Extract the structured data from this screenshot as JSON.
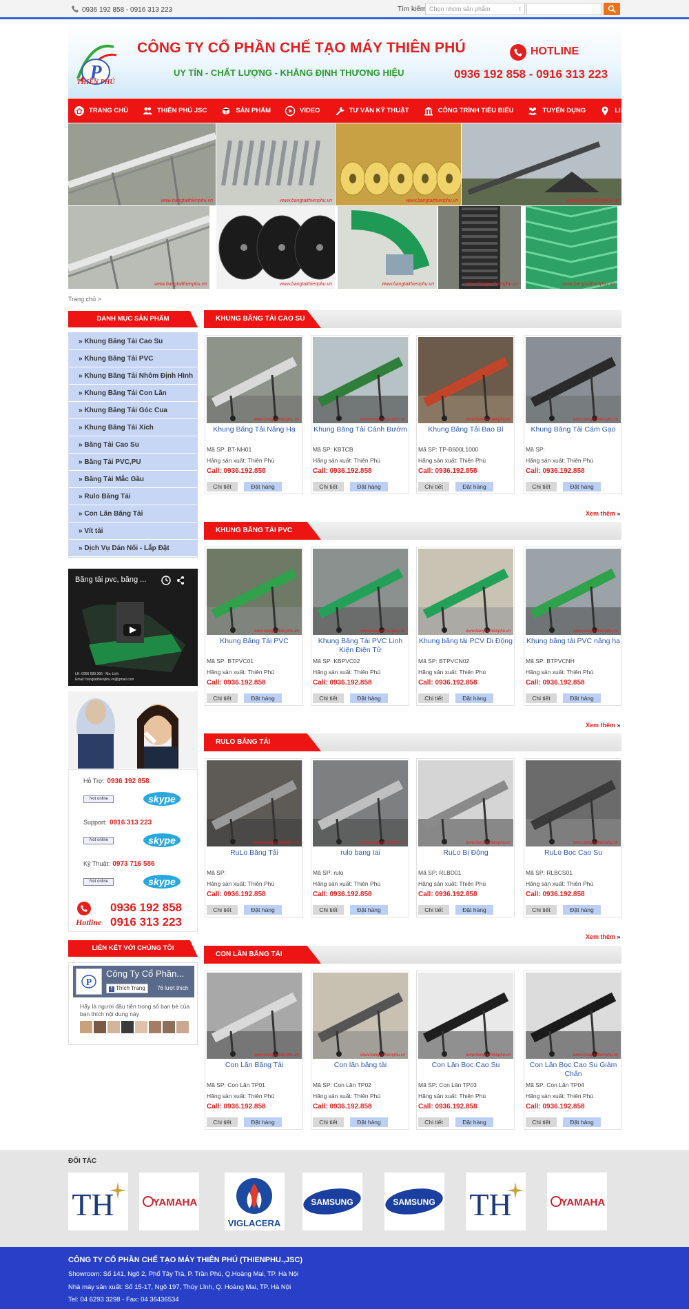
{
  "topbar": {
    "phone": "0936 192 858 - 0916 313 223",
    "search_label": "Tìm kiếm",
    "select_value": "Chọn nhóm sản phẩm",
    "search_value": ""
  },
  "header": {
    "company": "CÔNG TY CỔ PHẦN CHẾ TẠO MÁY THIÊN PHÚ",
    "slogan": "UY TÍN - CHẤT LƯỢNG - KHẲNG ĐỊNH THƯƠNG HIỆU",
    "hotline_label": "HOTLINE",
    "hotline_numbers": "0936 192 858 - 0916 313 223",
    "logo_text": "THIÊN PHÚ",
    "logo_letter": "P"
  },
  "nav": [
    {
      "label": "TRANG CHỦ",
      "icon": "home-icon"
    },
    {
      "label": "THIÊN PHÚ JSC",
      "icon": "users-icon"
    },
    {
      "label": "SẢN PHẨM",
      "icon": "box-icon"
    },
    {
      "label": "VIDEO",
      "icon": "play-icon"
    },
    {
      "label": "TƯ VẤN KỸ THUẬT",
      "icon": "wrench-icon"
    },
    {
      "label": "CÔNG TRÌNH TIÊU BIỂU",
      "icon": "building-icon"
    },
    {
      "label": "TUYỂN DỤNG",
      "icon": "people-icon"
    },
    {
      "label": "LIÊN HỆ",
      "icon": "pin-icon"
    }
  ],
  "breadcrumb": "Trang chủ >",
  "sidebar": {
    "title": "DANH MỤC SẢN PHẨM",
    "items": [
      "Khung Băng Tải Cao Su",
      "Khung Băng Tải PVC",
      "Khung Băng Tải Nhôm Định Hình",
      "Khung Băng Tải Con Lăn",
      "Khung Băng Tải Góc Cua",
      "Khung Băng Tải Xích",
      "Băng Tải Cao Su",
      "Băng Tải PVC,PU",
      "Băng Tải Mắc Gầu",
      "Rulo Băng Tải",
      "Con Lăn Băng Tải",
      "Vít tải",
      "Dịch Vụ Dán Nối - Lắp Đặt"
    ]
  },
  "video": {
    "title": "Băng tải pvc, băng ...",
    "caption": "LH: 0966 699 366 - Ms: Linh",
    "caption2": "Email: bangtaithienphu.vn@gmail.com"
  },
  "support": {
    "rows": [
      {
        "label": "Hỗ Trợ:",
        "phone": "0936 192 858"
      },
      {
        "label": "Support:",
        "phone": "0916 313 223"
      },
      {
        "label": "Kỹ Thuật:",
        "phone": "0973 716 586"
      }
    ],
    "online": "Not online",
    "skype": "skype",
    "big1": "0936 192 858",
    "big2": "0916 313 223",
    "hotline": "Hotline"
  },
  "links": {
    "title": "LIÊN KẾT VỚI CHÚNG TÔI",
    "fb_page": "Công Ty Cổ Phần...",
    "like": "Thích Trang",
    "likes": "76 lượt thích",
    "note": "Hãy là người đầu tiên trong số bạn bè của bạn thích nội dung này"
  },
  "sections": [
    {
      "title": "KHUNG BĂNG TẢI CAO SU",
      "more": "Xem thêm",
      "products": [
        {
          "name": "Khung Băng Tải Nâng Hạ",
          "code": "Mã SP: BT-NH01",
          "maker": "Hãng sản xuất: Thiên Phú",
          "call": "Call: 0936.192.858"
        },
        {
          "name": "Khung Băng Tải Cánh Bướm",
          "code": "Mã SP: KBTCB",
          "maker": "Hãng sản xuất: Thiên Phú",
          "call": "Call: 0936.192.858"
        },
        {
          "name": "Khung Băng Tải Bao Bì",
          "code": "Mã SP: TP-B600L1000",
          "maker": "Hãng sản xuất: Thiên Phú",
          "call": "Call: 0936.192.858"
        },
        {
          "name": "Khung Băng Tải Cám Gạo",
          "code": "Mã SP:",
          "maker": "Hãng sản xuất: Thiên Phú",
          "call": "Call: 0936.192.858"
        }
      ]
    },
    {
      "title": "KHUNG BĂNG TẢI PVC",
      "more": "Xem thêm",
      "products": [
        {
          "name": "Khung Băng Tải PVC",
          "code": "Mã SP: BTPVC01",
          "maker": "Hãng sản xuất: Thiên Phú",
          "call": "Call: 0936.192.858"
        },
        {
          "name": "Khung Băng Tải PVC Linh Kiện Điện Tử",
          "code": "Mã SP: KBPVC02",
          "maker": "Hãng sản xuất: Thiên Phú",
          "call": "Call: 0936.192.858"
        },
        {
          "name": "Khung băng tải PCV Di Động",
          "code": "Mã SP: BTPVCN02",
          "maker": "Hãng sản xuất: Thiên Phú",
          "call": "Call: 0936.192.858"
        },
        {
          "name": "Khung băng tải PVC nâng hạ",
          "code": "Mã SP: BTPVCNH",
          "maker": "Hãng sản xuất: Thiên Phú",
          "call": "Call: 0936.192.858"
        }
      ]
    },
    {
      "title": "RULO BĂNG TẢI",
      "more": "Xem thêm",
      "products": [
        {
          "name": "RuLo Băng Tải",
          "code": "Mã SP:",
          "maker": "Hãng sản xuất: Thiên Phú",
          "call": "Call: 0936.192.858"
        },
        {
          "name": "rulo bang tai",
          "code": "Mã SP: rulo",
          "maker": "Hãng sản xuất: Thiên Phú",
          "call": "Call: 0936.192.858"
        },
        {
          "name": "RuLo Bị Động",
          "code": "Mã SP: RLBD01",
          "maker": "Hãng sản xuất: Thiên Phú",
          "call": "Call: 0936.192.858"
        },
        {
          "name": "RuLo Bọc Cao Su",
          "code": "Mã SP: RLBCS01",
          "maker": "Hãng sản xuất: Thiên Phú",
          "call": "Call: 0936.192.858"
        }
      ]
    },
    {
      "title": "CON LĂN BĂNG TẢI",
      "more": "",
      "products": [
        {
          "name": "Con Lăn Băng Tải",
          "code": "Mã SP: Con Lăn TP01",
          "maker": "Hãng sản xuất: Thiên Phú",
          "call": "Call: 0936.192.858"
        },
        {
          "name": "Con lăn băng tải",
          "code": "Mã SP: Con Lăn TP02",
          "maker": "Hãng sản xuất: Thiên Phú",
          "call": "Call: 0936.192.858"
        },
        {
          "name": "Con Lăn Bọc Cao Su",
          "code": "Mã SP: Con Lăn TP03",
          "maker": "Hãng sản xuất: Thiên Phú",
          "call": "Call: 0936.192.858"
        },
        {
          "name": "Con Lăn Bọc Cao Su Giảm Chấn",
          "code": "Mã SP: Con Lăn TP04",
          "maker": "Hãng sản xuất: Thiên Phú",
          "call": "Call: 0936.192.858"
        }
      ]
    }
  ],
  "buttons": {
    "detail": "Chi tiết",
    "order": "Đặt hàng"
  },
  "watermark": "www.bangtaithienphu.vn",
  "partners": {
    "title": "ĐỐI TÁC",
    "logos": [
      "TH",
      "YAMAHA",
      "VIGLACERA",
      "SAMSUNG",
      "SAMSUNG",
      "TH",
      "YAMAHA"
    ]
  },
  "footer": {
    "title": "CÔNG TY CỔ PHẦN CHẾ TẠO MÁY THIÊN PHÚ (THIENPHU.,JSC)",
    "lines": [
      "Showroom: Số 141, Ngõ 2, Phố Tây Trà, P. Trần Phú, Q.Hoàng Mai, TP. Hà Nội",
      "Nhà máy sản xuất: Số 15-17, Ngõ 197, Thúy Lĩnh, Q. Hoàng Mai, TP. Hà Nội",
      "Tel: 04 6293 3298 - Fax: 04 36436534"
    ]
  },
  "colors": {
    "accent_red": "#ef1414",
    "footer_blue": "#2840c8",
    "link_blue": "#2b59c3",
    "menu_bg": "#c7d6f5",
    "search_orange": "#f0701a"
  }
}
